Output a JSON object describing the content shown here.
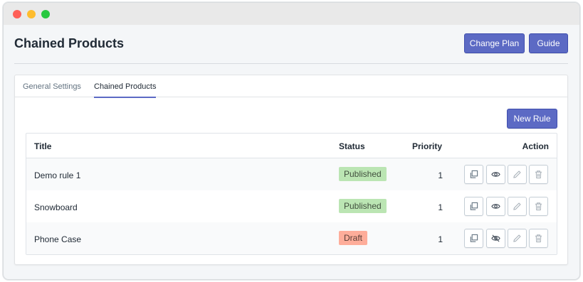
{
  "window": {
    "controls": [
      "close",
      "minimize",
      "maximize"
    ]
  },
  "header": {
    "title": "Chained Products",
    "change_plan_label": "Change Plan",
    "guide_label": "Guide"
  },
  "tabs": [
    {
      "label": "General Settings",
      "active": false
    },
    {
      "label": "Chained Products",
      "active": true
    }
  ],
  "new_rule_label": "New Rule",
  "table": {
    "columns": {
      "title": "Title",
      "status": "Status",
      "priority": "Priority",
      "action": "Action"
    },
    "rows": [
      {
        "title": "Demo rule 1",
        "status": "Published",
        "priority": "1",
        "visibility_icon": "eye-icon"
      },
      {
        "title": "Snowboard",
        "status": "Published",
        "priority": "1",
        "visibility_icon": "eye-icon"
      },
      {
        "title": "Phone Case",
        "status": "Draft",
        "priority": "1",
        "visibility_icon": "eye-off-icon"
      }
    ],
    "action_icons": [
      "duplicate-icon",
      "visibility-icon",
      "edit-icon",
      "delete-icon"
    ]
  },
  "colors": {
    "accent": "#5c6ac4",
    "published_badge": "#bbe5b3",
    "draft_badge": "#fead9a",
    "background": "#f4f6f8"
  }
}
